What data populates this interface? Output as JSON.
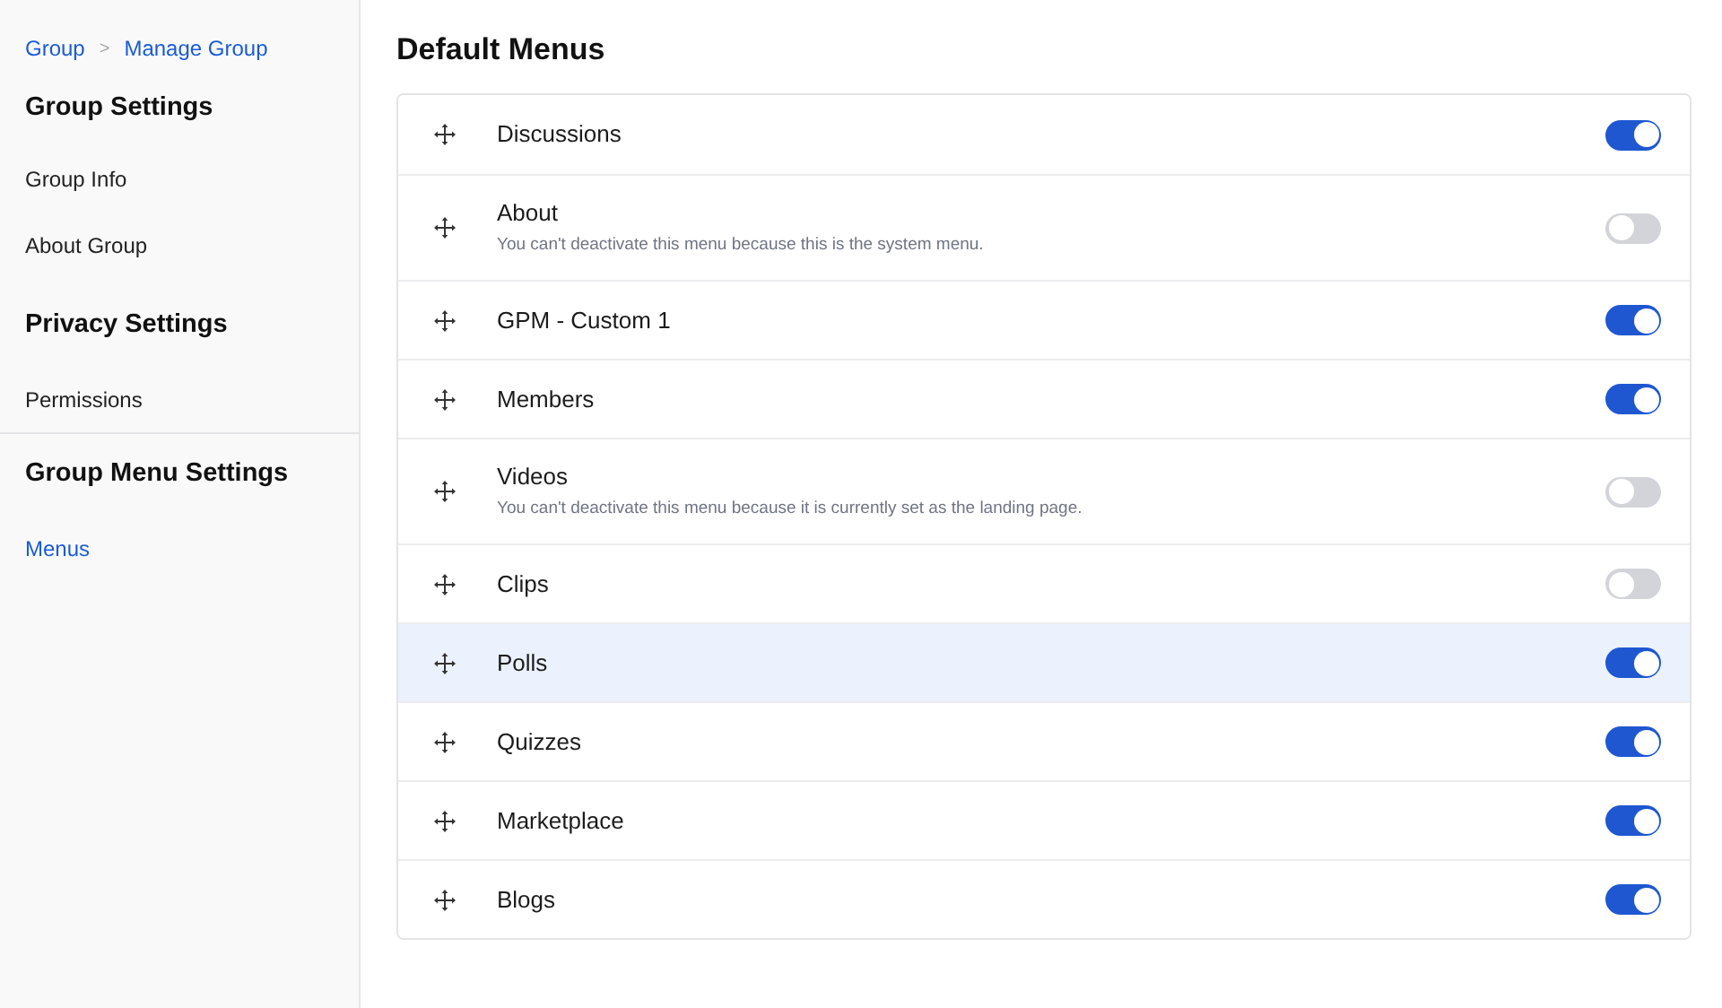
{
  "breadcrumb": [
    {
      "label": "Group"
    },
    {
      "label": "Manage Group"
    }
  ],
  "breadcrumb_separator": ">",
  "sidebar": {
    "sections": [
      {
        "title": "Group Settings",
        "divider_before": false,
        "items": [
          {
            "label": "Group Info",
            "selected": false
          },
          {
            "label": "About Group",
            "selected": false
          }
        ]
      },
      {
        "title": "Privacy Settings",
        "divider_before": false,
        "items": [
          {
            "label": "Permissions",
            "selected": false
          }
        ]
      },
      {
        "title": "Group Menu Settings",
        "divider_before": true,
        "items": [
          {
            "label": "Menus",
            "selected": true
          }
        ]
      }
    ]
  },
  "main": {
    "title": "Default Menus",
    "menus": [
      {
        "label": "Discussions",
        "on": true,
        "selected": false
      },
      {
        "label": "About",
        "note": "You can't deactivate this menu because this is the system menu.",
        "on": false,
        "selected": false
      },
      {
        "label": "GPM - Custom 1",
        "on": true,
        "selected": false
      },
      {
        "label": "Members",
        "on": true,
        "selected": false
      },
      {
        "label": "Videos",
        "note": "You can't deactivate this menu because it is currently set as the landing page.",
        "on": false,
        "selected": false
      },
      {
        "label": "Clips",
        "on": false,
        "selected": false
      },
      {
        "label": "Polls",
        "on": true,
        "selected": true
      },
      {
        "label": "Quizzes",
        "on": true,
        "selected": false
      },
      {
        "label": "Marketplace",
        "on": true,
        "selected": false
      },
      {
        "label": "Blogs",
        "on": true,
        "selected": false
      }
    ]
  }
}
